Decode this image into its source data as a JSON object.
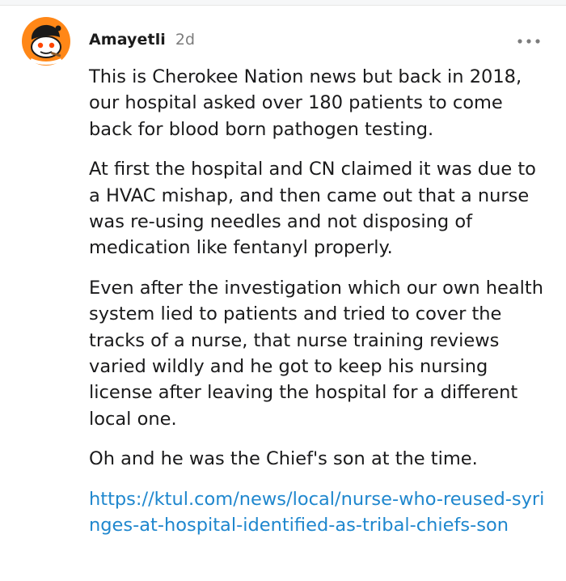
{
  "comment": {
    "author": "Amayetli",
    "timestamp": "2d",
    "paragraphs": [
      "This is Cherokee Nation news but back in 2018, our hospital asked over 180 patients to come back for blood born pathogen testing.",
      "At first the hospital and CN claimed it was due to a HVAC mishap, and then came out that a nurse was re-using needles and not disposing of medication like fentanyl properly.",
      "Even after the investigation which our own health system lied to patients and tried to cover the tracks of a nurse, that nurse training reviews varied wildly and he got to keep his nursing license after leaving the hospital for a different local one.",
      "Oh and he was the Chief's son at the time."
    ],
    "link": {
      "text": "https://ktul.com/news/local/nurse-who-reused-syringes-at-hospital-identified-as-tribal-chiefs-son"
    }
  },
  "icons": {
    "avatar": "snoo-avatar-icon",
    "more": "more-options-icon"
  },
  "colors": {
    "avatar_bg": "#ff8717",
    "link": "#1f87ce",
    "meta": "#7c7c7c",
    "text": "#1a1a1b"
  }
}
